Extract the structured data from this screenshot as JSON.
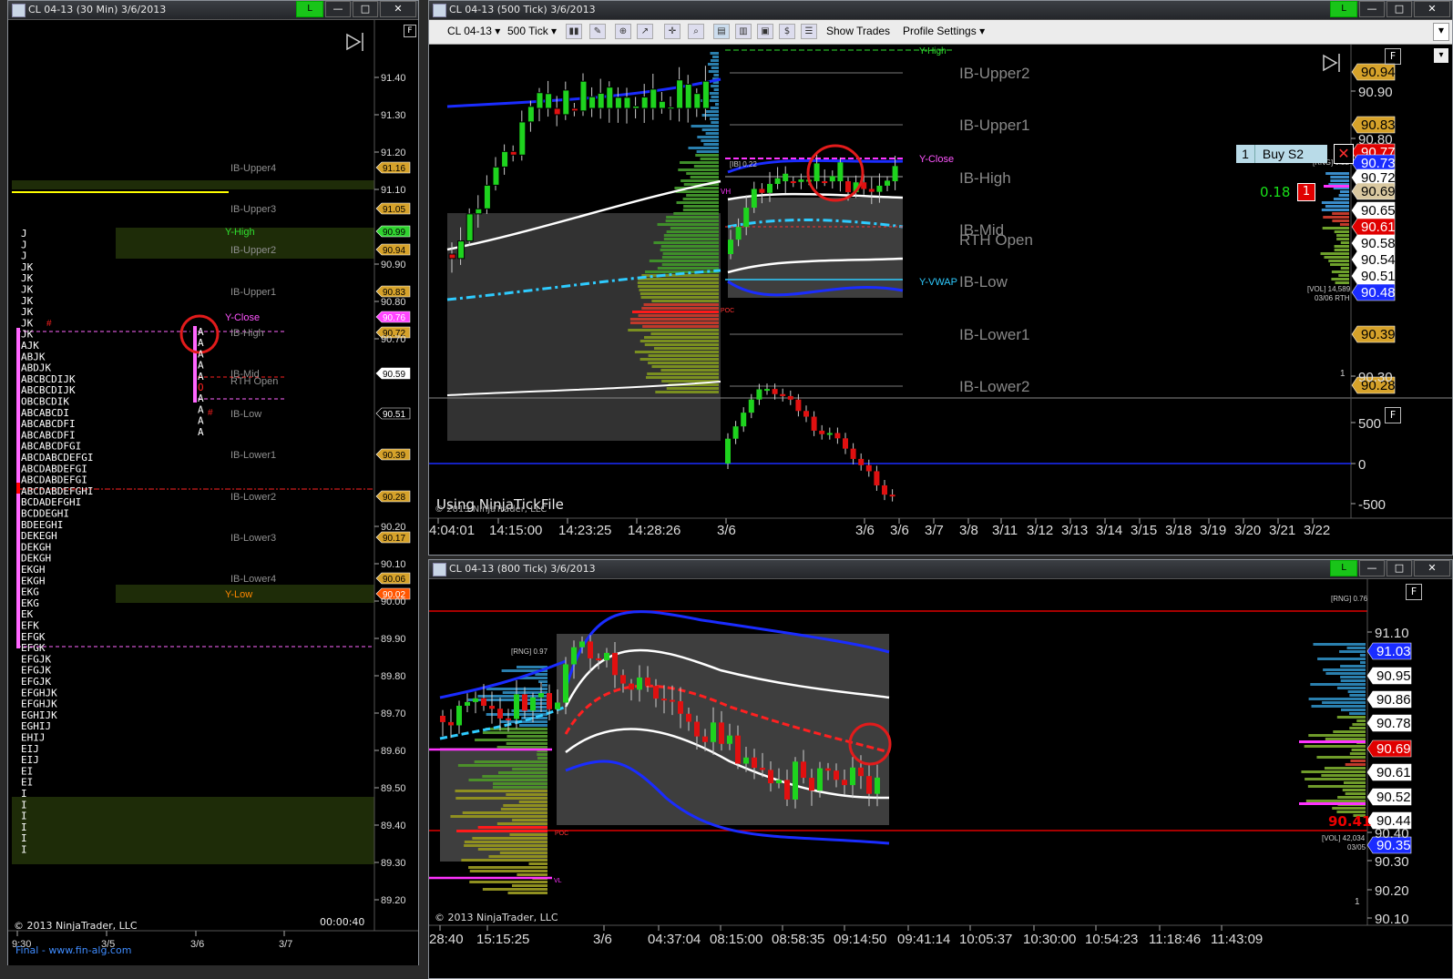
{
  "windows": {
    "left": {
      "title": "CL 04-13 (30 Min)  3/6/2013"
    },
    "top": {
      "title": "CL 04-13 (500 Tick)  3/6/2013"
    },
    "bottom": {
      "title": "CL 04-13 (800 Tick)  3/6/2013"
    }
  },
  "window_buttons": {
    "connect": "L",
    "minimize": "—",
    "maximize": "□",
    "close": "✕"
  },
  "toolbar": {
    "instrument": "CL 04-13",
    "interval": "500 Tick",
    "show_trades": "Show Trades",
    "profile_settings": "Profile Settings"
  },
  "left_chart": {
    "f_button": "F",
    "levels": [
      {
        "label": "IB-Upper4",
        "price": "91.16"
      },
      {
        "label": "IB-Upper3",
        "price": "91.05"
      },
      {
        "label": "Y-High",
        "price": "90.99"
      },
      {
        "label": "IB-Upper2",
        "price": "90.94"
      },
      {
        "label": "IB-Upper1",
        "price": "90.83"
      },
      {
        "label": "Y-Close",
        "price": "90.76"
      },
      {
        "label": "IB-High",
        "price": "90.72"
      },
      {
        "label": "IB-Mid",
        "price": "90.59"
      },
      {
        "label": "RTH Open",
        "price": ""
      },
      {
        "label": "IB-Low",
        "price": "90.51"
      },
      {
        "label": "IB-Lower1",
        "price": "90.39"
      },
      {
        "label": "IB-Lower2",
        "price": "90.28"
      },
      {
        "label": "IB-Lower3",
        "price": "90.17"
      },
      {
        "label": "IB-Lower4",
        "price": "90.06"
      },
      {
        "label": "Y-Low",
        "price": "90.02"
      }
    ],
    "y_axis": [
      "91.40",
      "91.30",
      "91.20",
      "91.10",
      "90.90",
      "90.80",
      "90.70",
      "90.20",
      "90.10",
      "90.00",
      "89.90",
      "89.80",
      "89.70",
      "89.60",
      "89.50",
      "89.40",
      "89.30",
      "89.20"
    ],
    "tpo_rows": [
      "J",
      "J",
      "J",
      "JK",
      "JK",
      "JK",
      "JK",
      "JK",
      "JK",
      "JK",
      "AJK",
      "ABJK",
      "ABDJK",
      "ABCBCDIJK",
      "ABCBCDIJK",
      "OBCBCDIK",
      "ABCABCDI",
      "ABCABCDFI",
      "ABCABCDFI",
      "ABCABCDFGI",
      "ABCDABCDEFGI",
      "ABCDABDEFGI",
      "ABCDABDEFGI",
      "ABCDABDEFGHI",
      "BCDADEFGHI",
      "BCDDEGHI",
      "BDEEGHI",
      "DEKEGH",
      "DEKGH",
      "DEKGH",
      "EKGH",
      "EKGH",
      "EKG",
      "EKG",
      "EK",
      "EFK",
      "EFGK",
      "EFGK",
      "EFGJK",
      "EFGJK",
      "EFGJK",
      "EFGHJK",
      "EFGHJK",
      "EGHIJK",
      "EGHIJ",
      "EHIJ",
      "EIJ",
      "EIJ",
      "EI",
      "EI",
      "I",
      "I",
      "I",
      "I",
      "I",
      "I"
    ],
    "today_tpo": [
      "A",
      "A",
      "A",
      "A",
      "A",
      "O",
      "A",
      "A",
      "A",
      "A"
    ],
    "copyright": "© 2013 NinjaTrader, LLC",
    "clock": "00:00:40",
    "x_axis": [
      "9:30",
      "3/5",
      "3/6",
      "3/7"
    ],
    "footer_link": "Final - www.fin-alg.com"
  },
  "top_chart": {
    "f_button": "F",
    "levels": [
      "Y-High",
      "IB-Upper2",
      "IB-Upper1",
      "Y-Close",
      "IB-High",
      "IB-Mid",
      "RTH Open",
      "Y-VWAP",
      "IB-Low",
      "IB-Lower1",
      "IB-Lower2"
    ],
    "price_tags": [
      "90.94",
      "90.83",
      "90.77",
      "90.73",
      "90.72",
      "90.69",
      "90.65",
      "90.61",
      "90.58",
      "90.54",
      "90.51",
      "90.48",
      "90.39",
      "90.28"
    ],
    "y_axis": [
      "90.90",
      "90.80",
      "90.30"
    ],
    "order": {
      "qty": "1",
      "label": "Buy S2",
      "pnl": "0.18",
      "pos": "1"
    },
    "small_labels": {
      "ib": "[IB] 0.22",
      "rng": "[RNG] 0.22",
      "vol": "[VOL] 14,589",
      "vol_date": "03/06 RTH",
      "vh": "VH",
      "poc": "POC",
      "one": "1"
    },
    "osc_axis": [
      "500",
      "0",
      "-500"
    ],
    "using": "Using NinjaTickFile",
    "copyright": "© 2013 NinjaTrader, LLC",
    "x_axis": [
      "4:04:01",
      "14:15:00",
      "14:23:25",
      "14:28:26",
      "3/6",
      "3/6",
      "3/6",
      "3/7",
      "3/8",
      "3/11",
      "3/12",
      "3/13",
      "3/14",
      "3/15",
      "3/18",
      "3/19",
      "3/20",
      "3/21",
      "3/22"
    ]
  },
  "bottom_chart": {
    "f_button": "F",
    "y_axis": [
      "91.10",
      "90.40",
      "90.30",
      "90.20",
      "90.10"
    ],
    "price_tags": [
      "91.03",
      "90.95",
      "90.86",
      "90.78",
      "90.69",
      "90.61",
      "90.52",
      "90.44",
      "90.35"
    ],
    "red_level": "90.41",
    "small_labels": {
      "rng_l": "[RNG] 0.97",
      "rng_r": "[RNG] 0.76",
      "vol": "[VOL] 42,034",
      "vol_date": "03/05",
      "poc": "POC",
      "vl": "VL",
      "one": "1"
    },
    "copyright": "© 2013 NinjaTrader, LLC",
    "x_axis": [
      "28:40",
      "15:15:25",
      "3/6",
      "04:37:04",
      "08:15:00",
      "08:58:35",
      "09:14:50",
      "09:41:14",
      "10:05:37",
      "10:30:00",
      "10:54:23",
      "11:18:46",
      "11:43:09"
    ]
  }
}
